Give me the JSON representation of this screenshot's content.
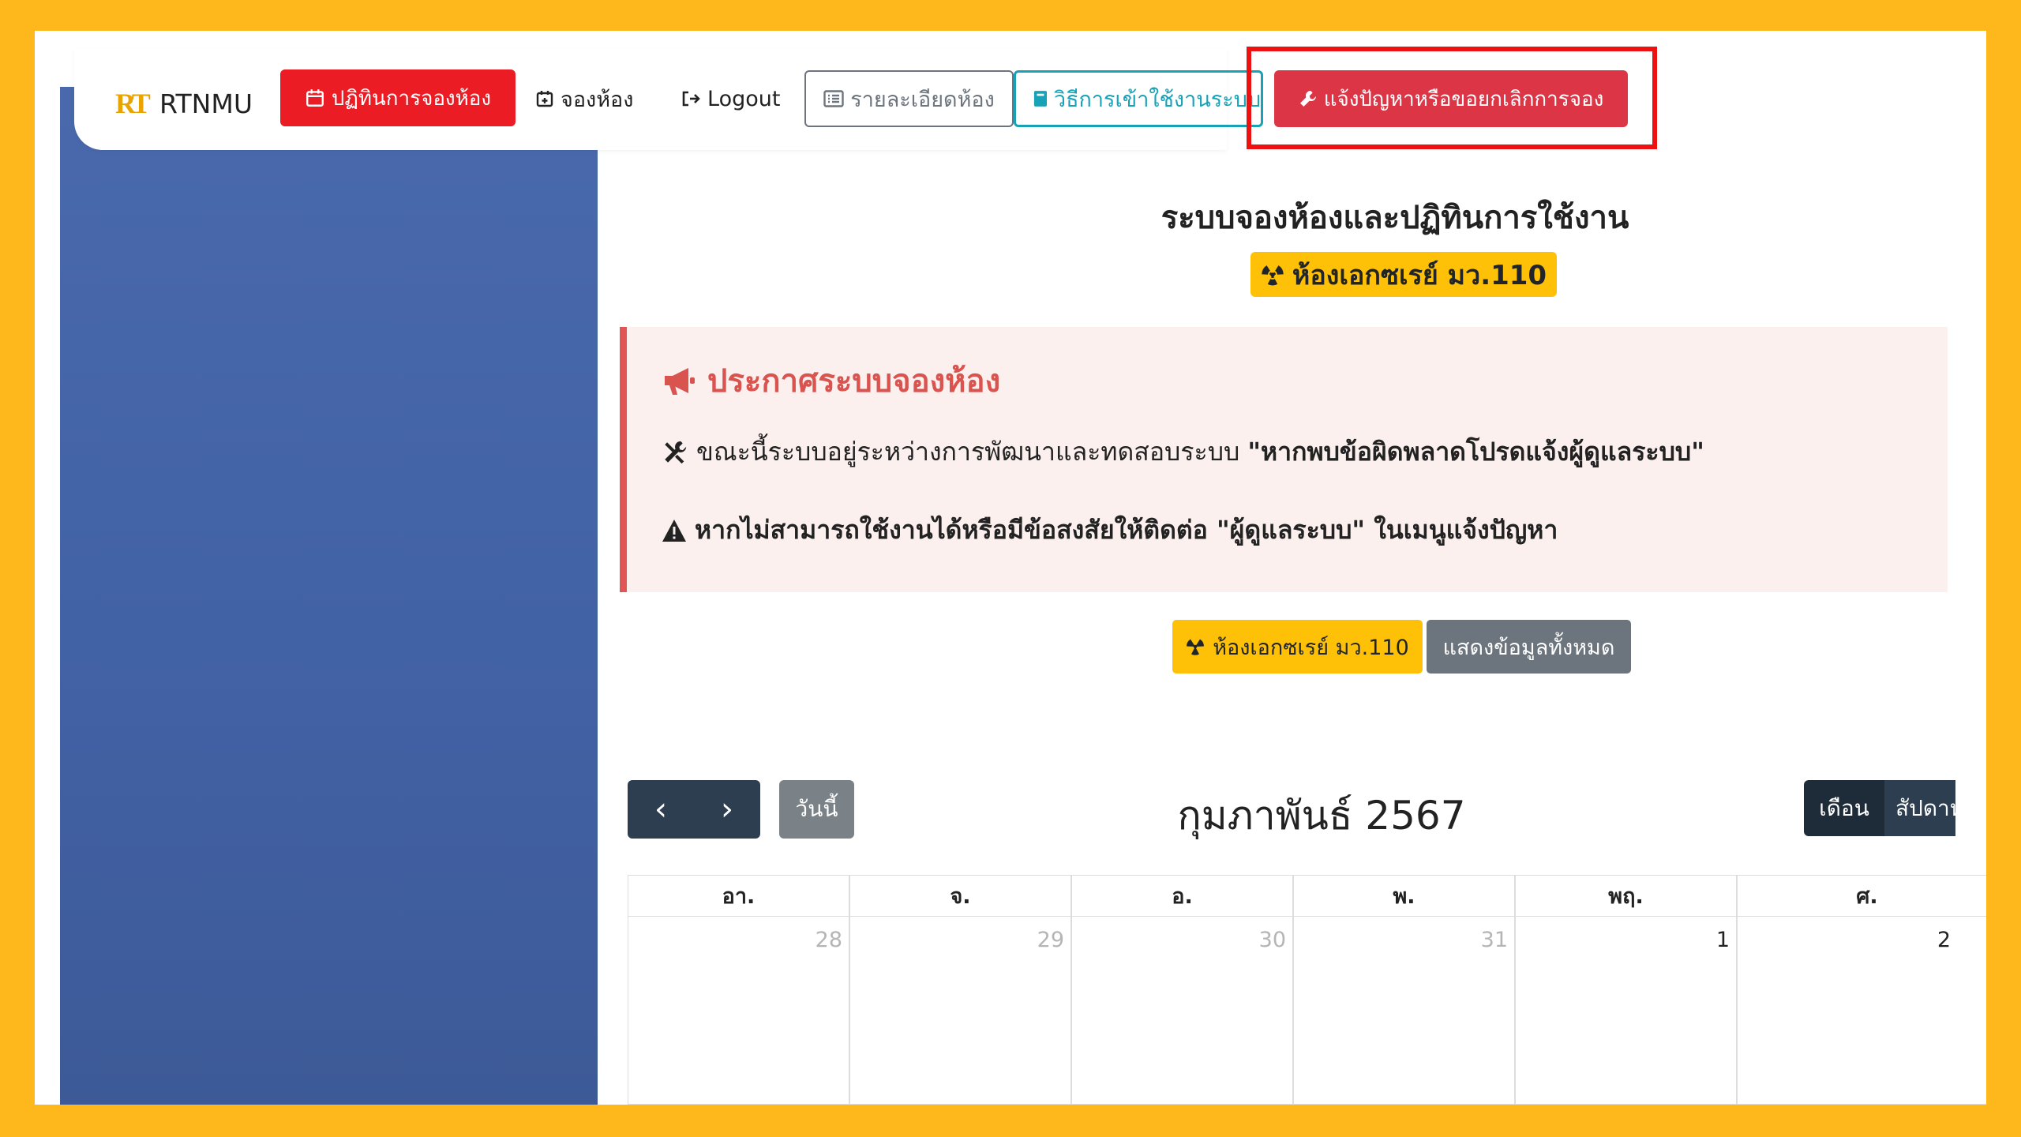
{
  "navbar": {
    "brand_logo": "RT",
    "brand_name": "RTNMU",
    "calendar_label": "ปฏิทินการจองห้อง",
    "book_label": "จองห้อง",
    "logout_label": "Logout",
    "details_label": "รายละเอียดห้อง",
    "howto_label": "วิธีการเข้าใช้งานระบบ",
    "report_label": "แจ้งปัญหาหรือขอยกเลิกการจอง"
  },
  "main": {
    "title": "ระบบจองห้องและปฏิทินการใช้งาน",
    "room_badge": "ห้องเอกซเรย์ มว.110"
  },
  "announcement": {
    "title": "ประกาศระบบจองห้อง",
    "line1_text": "ขณะนี้ระบบอยู่ระหว่างการพัฒนาและทดสอบระบบ",
    "line1_bold": "\"หากพบข้อผิดพลาดโปรดแจ้งผู้ดูแลระบบ\"",
    "line2_text": "หากไม่สามารถใช้งานได้หรือมีข้อสงสัยให้ติดต่อ \"ผู้ดูแลระบบ\" ในเมนูแจ้งปัญหา"
  },
  "filters": {
    "room_button": "ห้องเอกซเรย์ มว.110",
    "all_button": "แสดงข้อมูลทั้งหมด"
  },
  "calendar": {
    "prev": "‹",
    "next": "›",
    "today": "วันนี้",
    "title": "กุมภาพันธ์ 2567",
    "view_month": "เดือน",
    "view_week": "สัปดาห์",
    "weekdays": [
      "อา.",
      "จ.",
      "อ.",
      "พ.",
      "พฤ.",
      "ศ."
    ],
    "first_week": [
      "28",
      "29",
      "30",
      "31",
      "1",
      "2"
    ]
  },
  "colors": {
    "frame": "#FFB81C",
    "danger": "#dc3545",
    "warning": "#ffc107",
    "info": "#17a2b8",
    "sidebar": "#4262a6",
    "calendar_dark": "#2c3e50"
  }
}
